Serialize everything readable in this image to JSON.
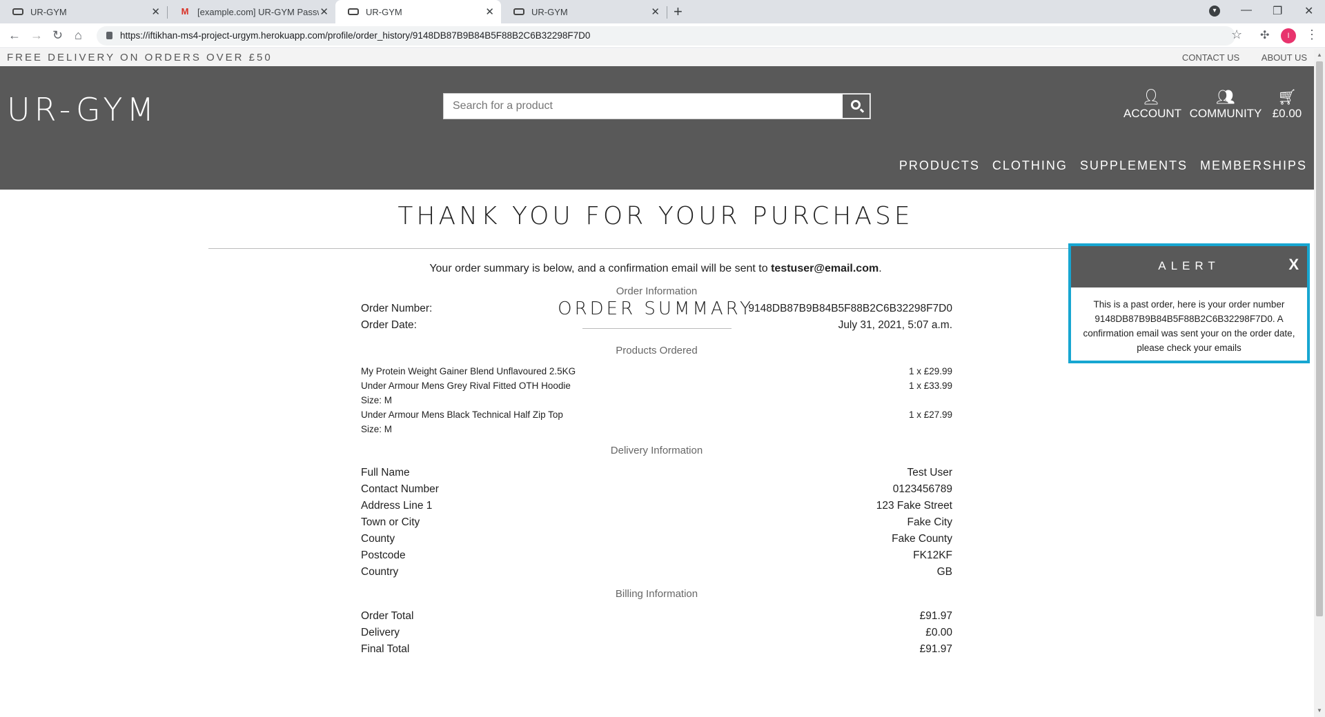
{
  "browser": {
    "tabs": [
      {
        "title": "UR-GYM"
      },
      {
        "title": "[example.com] UR-GYM Passwor"
      },
      {
        "title": "UR-GYM"
      },
      {
        "title": "UR-GYM"
      }
    ],
    "url": "https://iftikhan-ms4-project-urgym.herokuapp.com/profile/order_history/9148DB87B9B84B5F88B2C6B32298F7D0",
    "profile_initial": "I"
  },
  "promo": {
    "text": "FREE DELIVERY ON ORDERS OVER £50",
    "links": [
      "CONTACT US",
      "ABOUT US"
    ]
  },
  "header": {
    "logo": "UR-GYM",
    "search_placeholder": "Search for a product",
    "account_label": "ACCOUNT",
    "community_label": "COMMUNITY",
    "bag_total": "£0.00",
    "nav": [
      "PRODUCTS",
      "CLOTHING",
      "SUPPLEMENTS",
      "MEMBERSHIPS"
    ]
  },
  "content": {
    "title": "THANK YOU FOR YOUR PURCHASE",
    "lead_text": "Your order summary is below, and a confirmation email will be sent to",
    "lead_email": "testuser@email.com",
    "lead_end": ".",
    "summary_title": "ORDER SUMMARY",
    "order_info": {
      "heading": "Order Information",
      "number_label": "Order Number:",
      "number_value": "9148DB87B9B84B5F88B2C6B32298F7D0",
      "date_label": "Order Date:",
      "date_value": "July 31, 2021, 5:07 a.m."
    },
    "products": {
      "heading": "Products Ordered",
      "items": [
        {
          "name": "My Protein Weight Gainer Blend Unflavoured 2.5KG",
          "size": "",
          "qty": "1 x £29.99"
        },
        {
          "name": "Under Armour Mens Grey Rival Fitted OTH Hoodie",
          "size": "Size: M",
          "qty": "1 x £33.99"
        },
        {
          "name": "Under Armour Mens Black Technical Half Zip Top",
          "size": "Size: M",
          "qty": "1 x £27.99"
        }
      ]
    },
    "delivery": {
      "heading": "Delivery Information",
      "rows": [
        {
          "label": "Full Name",
          "value": "Test User"
        },
        {
          "label": "Contact Number",
          "value": "0123456789"
        },
        {
          "label": "Address Line 1",
          "value": "123 Fake Street"
        },
        {
          "label": "Town or City",
          "value": "Fake City"
        },
        {
          "label": "County",
          "value": "Fake County"
        },
        {
          "label": "Postcode",
          "value": "FK12KF"
        },
        {
          "label": "Country",
          "value": "GB"
        }
      ]
    },
    "billing": {
      "heading": "Billing Information",
      "rows": [
        {
          "label": "Order Total",
          "value": "£91.97"
        },
        {
          "label": "Delivery",
          "value": "£0.00"
        },
        {
          "label": "Final Total",
          "value": "£91.97"
        }
      ]
    }
  },
  "alert": {
    "title": "ALERT",
    "close": "X",
    "message": "This is a past order, here is your order number 9148DB87B9B84B5F88B2C6B32298F7D0. A confirmation email was sent your on the order date, please check your emails",
    "border_color": "#17a6d1"
  },
  "colors": {
    "header_bg": "#595959",
    "promo_bg": "#f3f3f3"
  }
}
